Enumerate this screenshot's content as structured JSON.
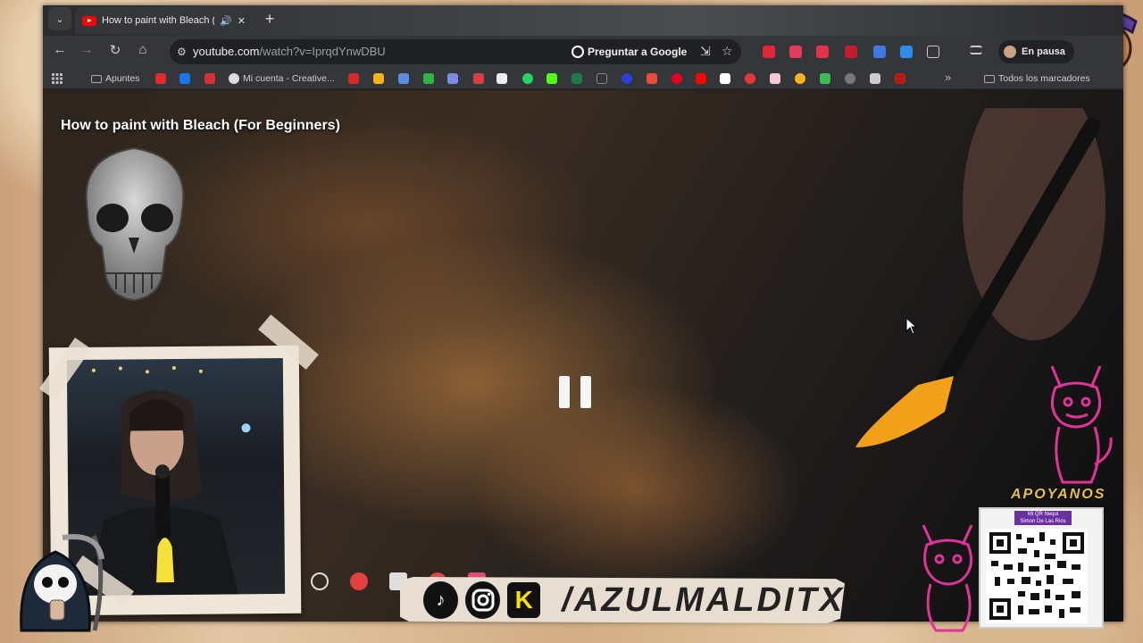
{
  "browser": {
    "tab": {
      "title": "How to paint with Bleach (F",
      "favicon": "youtube-icon",
      "audio": "speaker-icon"
    },
    "url": {
      "domain": "youtube.com",
      "path": "/watch?v=IprqdYnwDBU"
    },
    "ask_google": "Preguntar a Google",
    "profile": "En pausa"
  },
  "bookmarks": {
    "apps": "apps-grid-icon",
    "items": [
      {
        "label": "Apuntes",
        "type": "folder"
      },
      {
        "label": "Mi cuenta - Creative...",
        "type": "link"
      },
      {
        "label": "Todos los marcadores",
        "type": "folder"
      }
    ],
    "overflow": "»"
  },
  "video": {
    "title": "How to paint with Bleach (For Beginners)",
    "state": "paused"
  },
  "overlay": {
    "support_title": "APOYANOS",
    "qr_label_line1": "Mi QR Nequi",
    "qr_label_line2": "Simon De Las Rios",
    "handle": "/AZULMALDITX",
    "socials": [
      "tiktok-icon",
      "instagram-icon",
      "kick-icon"
    ]
  },
  "colors": {
    "yt_red": "#ff0000",
    "omnibox_bg": "#202124",
    "toolbar_bg": "#35363a",
    "devil_pink": "#e0339a",
    "support_gold": "#e6c24a"
  }
}
